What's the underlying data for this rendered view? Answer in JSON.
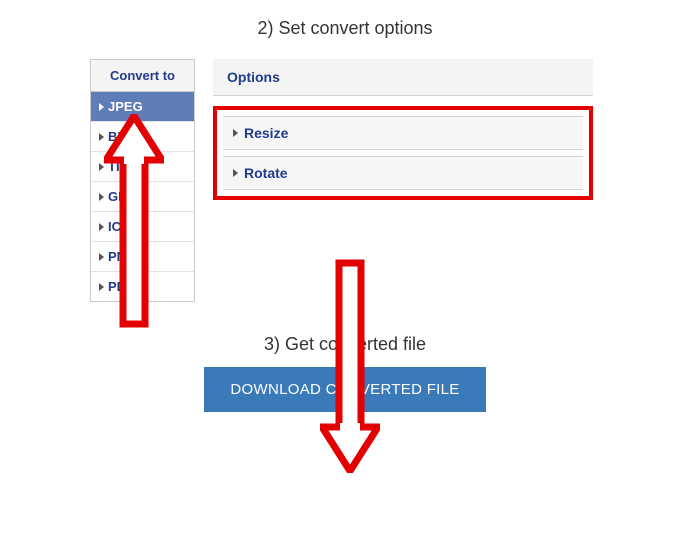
{
  "step2": {
    "heading": "2) Set convert options"
  },
  "sidebar": {
    "header": "Convert to",
    "items": [
      {
        "label": "JPEG",
        "active": true
      },
      {
        "label": "BMP"
      },
      {
        "label": "TIFF"
      },
      {
        "label": "GIF"
      },
      {
        "label": "ICO"
      },
      {
        "label": "PNG"
      },
      {
        "label": "PDF"
      }
    ]
  },
  "options": {
    "header": "Options",
    "rows": [
      {
        "label": "Resize"
      },
      {
        "label": "Rotate"
      }
    ]
  },
  "step3": {
    "heading": "3) Get converted file"
  },
  "download": {
    "label": "DOWNLOAD CONVERTED FILE"
  }
}
